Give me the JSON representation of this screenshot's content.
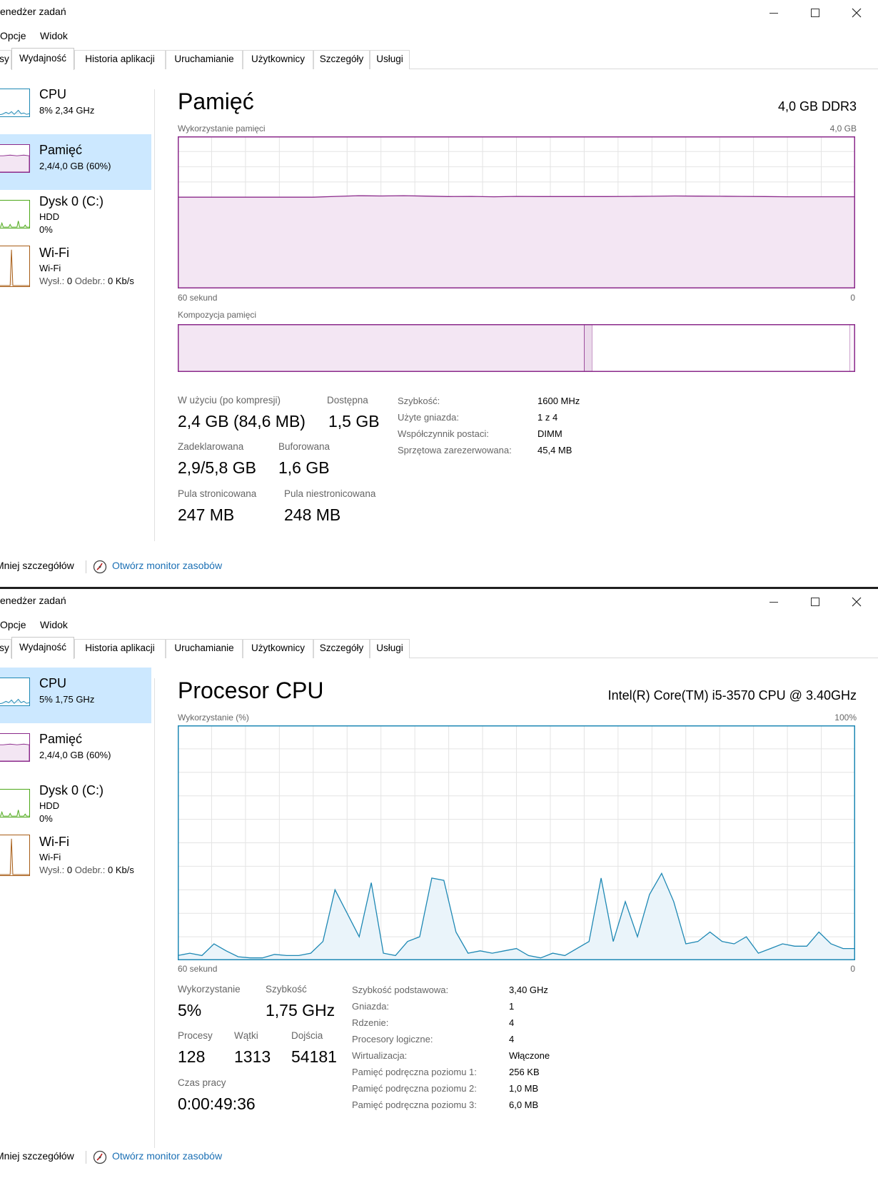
{
  "app": {
    "title": "enedżer zadań"
  },
  "menu": {
    "items": [
      "Opcje",
      "Widok"
    ]
  },
  "tabs": [
    "sy",
    "Wydajność",
    "Historia aplikacji",
    "Uruchamianie",
    "Użytkownicy",
    "Szczegóły",
    "Usługi"
  ],
  "active_tab": "Wydajność",
  "footer": {
    "less_details": "Mniej szczegółów",
    "open_monitor": "Otwórz monitor zasobów"
  },
  "colors": {
    "cpu": "#1e88b4",
    "memory": "#8b2a8b",
    "disk": "#4ca818",
    "wifi": "#a75c15",
    "selection": "#cce8ff",
    "link": "#1a6fb4"
  },
  "win1": {
    "sidebar": [
      {
        "name": "CPU",
        "line1": "8% 2,34 GHz",
        "icon": "cpu-graph-thumbnail"
      },
      {
        "name": "Pamięć",
        "line1": "2,4/4,0 GB (60%)",
        "icon": "memory-graph-thumbnail"
      },
      {
        "name": "Dysk 0 (C:)",
        "line1": "HDD",
        "line2": "0%",
        "icon": "disk-graph-thumbnail"
      },
      {
        "name": "Wi-Fi",
        "line1": "Wi-Fi",
        "send_label": "Wysł.:",
        "send_value": "0",
        "recv_label": "Odebr.:",
        "recv_value": "0 Kb/s",
        "icon": "wifi-graph-thumbnail"
      }
    ],
    "panel": {
      "title": "Pamięć",
      "spec": "4,0 GB DDR3",
      "usage_label": "Wykorzystanie pamięci",
      "usage_max": "4,0 GB",
      "axis_left": "60 sekund",
      "axis_right": "0",
      "composition_label": "Kompozycja pamięci",
      "usage_history_fraction": [
        0.6,
        0.6,
        0.6,
        0.6,
        0.6,
        0.6,
        0.6,
        0.605,
        0.61,
        0.608,
        0.61,
        0.607,
        0.604,
        0.605,
        0.603,
        0.605,
        0.604,
        0.604,
        0.604,
        0.604,
        0.605,
        0.606,
        0.608,
        0.607,
        0.606,
        0.605,
        0.604,
        0.603,
        0.603,
        0.603,
        0.603
      ],
      "composition": {
        "in_use_fraction": 0.6,
        "modified_fraction": 0.012,
        "standby_fraction": 0.38,
        "free_fraction": 0.008
      },
      "stats": {
        "in_use_label": "W użyciu (po kompresji)",
        "in_use": "2,4 GB (84,6 MB)",
        "available_label": "Dostępna",
        "available": "1,5 GB",
        "committed_label": "Zadeklarowana",
        "committed": "2,9/5,8 GB",
        "cached_label": "Buforowana",
        "cached": "1,6 GB",
        "paged_label": "Pula stronicowana",
        "paged": "247 MB",
        "nonpaged_label": "Pula niestronicowana",
        "nonpaged": "248 MB"
      },
      "specs": [
        {
          "key": "Szybkość:",
          "value": "1600 MHz"
        },
        {
          "key": "Użyte gniazda:",
          "value": "1 z 4"
        },
        {
          "key": "Współczynnik postaci:",
          "value": "DIMM"
        },
        {
          "key": "Sprzętowa zarezerwowana:",
          "value": "45,4 MB"
        }
      ]
    }
  },
  "win2": {
    "sidebar": [
      {
        "name": "CPU",
        "line1": "5% 1,75 GHz",
        "icon": "cpu-graph-thumbnail"
      },
      {
        "name": "Pamięć",
        "line1": "2,4/4,0 GB (60%)",
        "icon": "memory-graph-thumbnail"
      },
      {
        "name": "Dysk 0 (C:)",
        "line1": "HDD",
        "line2": "0%",
        "icon": "disk-graph-thumbnail"
      },
      {
        "name": "Wi-Fi",
        "line1": "Wi-Fi",
        "send_label": "Wysł.:",
        "send_value": "0",
        "recv_label": "Odebr.:",
        "recv_value": "0 Kb/s",
        "icon": "wifi-graph-thumbnail"
      }
    ],
    "panel": {
      "title": "Procesor CPU",
      "spec": "Intel(R) Core(TM) i5-3570 CPU @ 3.40GHz",
      "usage_label": "Wykorzystanie (%)",
      "usage_max": "100%",
      "axis_left": "60 sekund",
      "axis_right": "0",
      "usage_history_percent": [
        2,
        3,
        2,
        7,
        4,
        1.5,
        1,
        1,
        2.5,
        2,
        2,
        3,
        8,
        30,
        20,
        10,
        33,
        3,
        2,
        8,
        10,
        35,
        34,
        12,
        3,
        4,
        3,
        4,
        5,
        2,
        1,
        3,
        2,
        5,
        8,
        35,
        8,
        25,
        10,
        28,
        37,
        25,
        7,
        8,
        12,
        8,
        7,
        10,
        3,
        5,
        7,
        6,
        6,
        12,
        7,
        5,
        5
      ],
      "stats": {
        "util_label": "Wykorzystanie",
        "util": "5%",
        "speed_label": "Szybkość",
        "speed": "1,75 GHz",
        "processes_label": "Procesy",
        "processes": "128",
        "threads_label": "Wątki",
        "threads": "1313",
        "handles_label": "Dojścia",
        "handles": "54181",
        "uptime_label": "Czas pracy",
        "uptime": "0:00:49:36"
      },
      "specs": [
        {
          "key": "Szybkość podstawowa:",
          "value": "3,40 GHz"
        },
        {
          "key": "Gniazda:",
          "value": "1"
        },
        {
          "key": "Rdzenie:",
          "value": "4"
        },
        {
          "key": "Procesory logiczne:",
          "value": "4"
        },
        {
          "key": "Wirtualizacja:",
          "value": "Włączone"
        },
        {
          "key": "Pamięć podręczna poziomu 1:",
          "value": "256 KB"
        },
        {
          "key": "Pamięć podręczna poziomu 2:",
          "value": "1,0 MB"
        },
        {
          "key": "Pamięć podręczna poziomu 3:",
          "value": "6,0 MB"
        }
      ]
    }
  }
}
